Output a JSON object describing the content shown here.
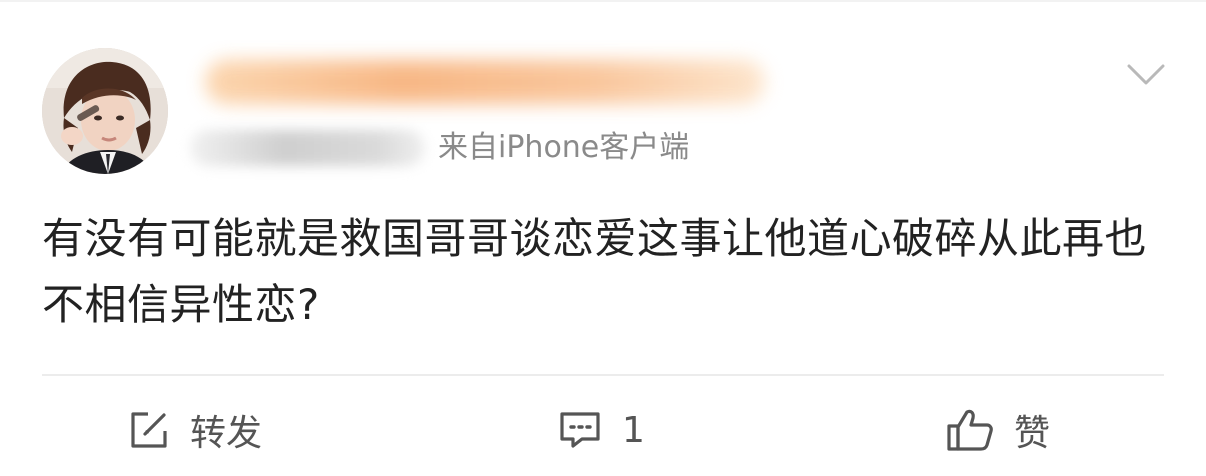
{
  "post": {
    "meta_text": "来自iPhone客户端",
    "content": "有没有可能就是救国哥哥谈恋爱这事让他道心破碎从此再也不相信异性恋?"
  },
  "actions": {
    "repost_label": "转发",
    "comment_count": "1",
    "like_label": "赞"
  },
  "icons": {
    "avatar": "profile-photo",
    "more": "chevron-down-icon",
    "repost": "repost-edit-icon",
    "comment": "comment-bubble-icon",
    "like": "thumbs-up-icon"
  },
  "colors": {
    "text": "#222222",
    "meta": "#8a8a8a",
    "icon": "#555555",
    "divider": "#ececec"
  }
}
